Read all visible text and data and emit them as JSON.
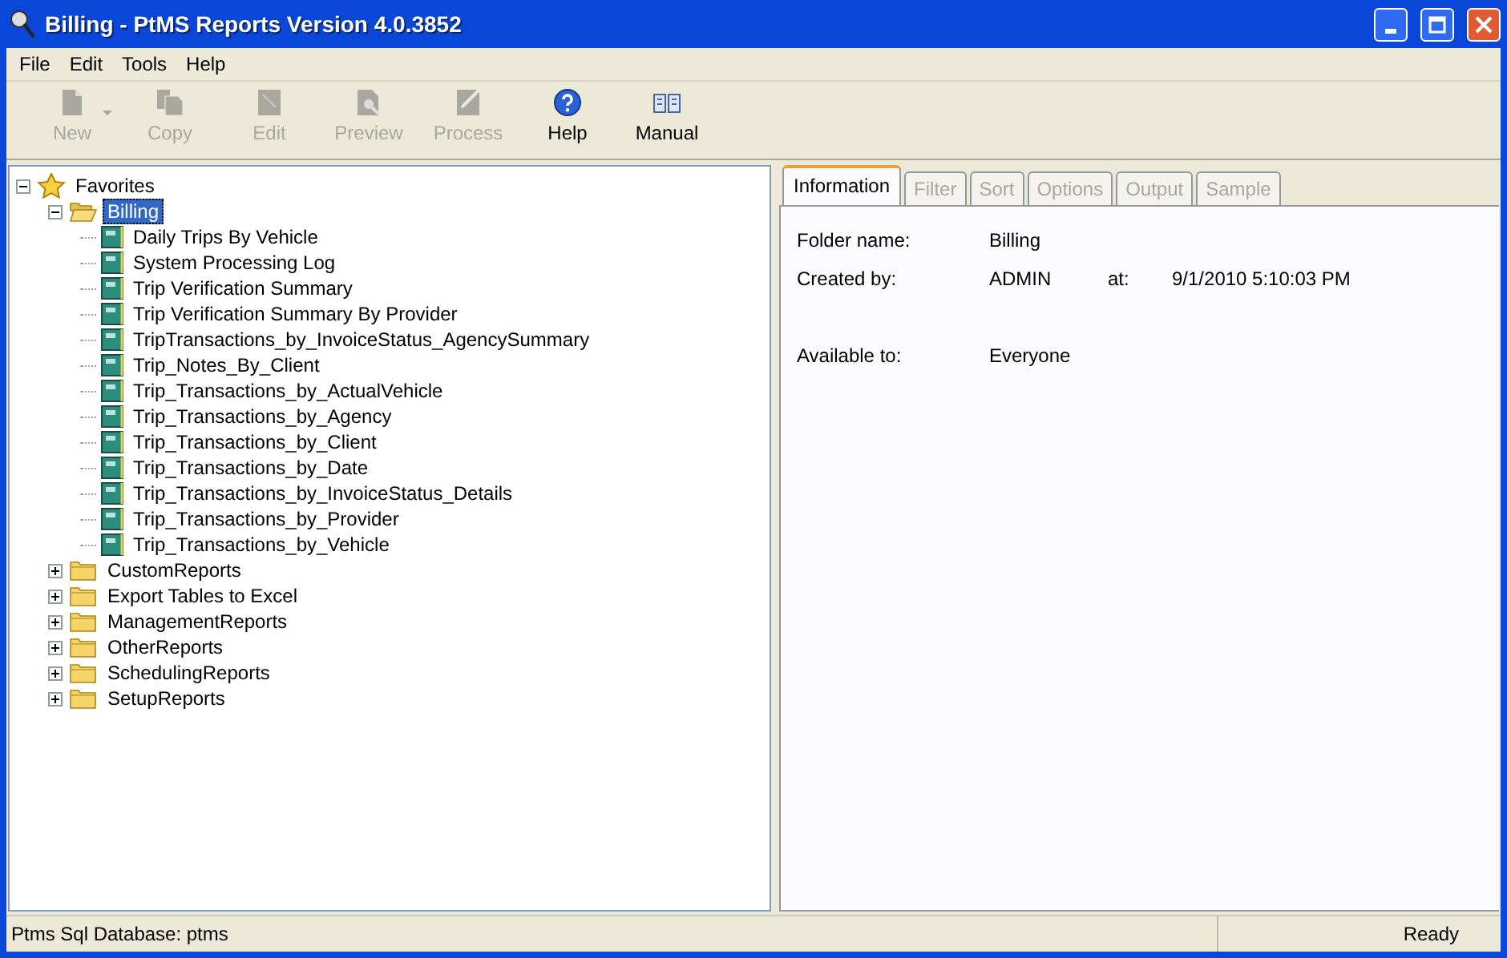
{
  "window": {
    "title": "Billing - PtMS Reports Version 4.0.3852"
  },
  "menu": [
    "File",
    "Edit",
    "Tools",
    "Help"
  ],
  "toolbar": [
    {
      "label": "New",
      "kind": "new",
      "disabled": true,
      "dropdown": true
    },
    {
      "label": "Copy",
      "kind": "copy",
      "disabled": true
    },
    {
      "label": "Edit",
      "kind": "edit",
      "disabled": true
    },
    {
      "label": "Preview",
      "kind": "preview",
      "disabled": true
    },
    {
      "label": "Process",
      "kind": "process",
      "disabled": true
    },
    {
      "label": "Help",
      "kind": "help",
      "disabled": false
    },
    {
      "label": "Manual",
      "kind": "manual",
      "disabled": false
    }
  ],
  "tree": [
    {
      "label": "Favorites",
      "kind": "favorites",
      "expanded": true,
      "selected": false,
      "children": [
        {
          "label": "Billing",
          "kind": "folder",
          "expanded": true,
          "selected": true,
          "children": [
            {
              "label": "Daily Trips By Vehicle",
              "kind": "report",
              "selected": false
            },
            {
              "label": "System Processing Log",
              "kind": "report",
              "selected": false
            },
            {
              "label": "Trip Verification Summary",
              "kind": "report",
              "selected": false
            },
            {
              "label": "Trip Verification Summary By Provider",
              "kind": "report",
              "selected": false
            },
            {
              "label": "TripTransactions_by_InvoiceStatus_AgencySummary",
              "kind": "report",
              "selected": false
            },
            {
              "label": "Trip_Notes_By_Client",
              "kind": "report",
              "selected": false
            },
            {
              "label": "Trip_Transactions_by_ActualVehicle",
              "kind": "report",
              "selected": false
            },
            {
              "label": "Trip_Transactions_by_Agency",
              "kind": "report",
              "selected": false
            },
            {
              "label": "Trip_Transactions_by_Client",
              "kind": "report",
              "selected": false
            },
            {
              "label": "Trip_Transactions_by_Date",
              "kind": "report",
              "selected": false
            },
            {
              "label": "Trip_Transactions_by_InvoiceStatus_Details",
              "kind": "report",
              "selected": false
            },
            {
              "label": "Trip_Transactions_by_Provider",
              "kind": "report",
              "selected": false
            },
            {
              "label": "Trip_Transactions_by_Vehicle",
              "kind": "report",
              "selected": false
            }
          ]
        },
        {
          "label": "CustomReports",
          "kind": "folder",
          "expanded": false,
          "selected": false
        },
        {
          "label": "Export Tables to Excel",
          "kind": "folder",
          "expanded": false,
          "selected": false
        },
        {
          "label": "ManagementReports",
          "kind": "folder",
          "expanded": false,
          "selected": false
        },
        {
          "label": "OtherReports",
          "kind": "folder",
          "expanded": false,
          "selected": false
        },
        {
          "label": "SchedulingReports",
          "kind": "folder",
          "expanded": false,
          "selected": false
        },
        {
          "label": "SetupReports",
          "kind": "folder",
          "expanded": false,
          "selected": false
        }
      ]
    }
  ],
  "tabs": [
    {
      "label": "Information",
      "selected": true,
      "disabled": false
    },
    {
      "label": "Filter",
      "selected": false,
      "disabled": true
    },
    {
      "label": "Sort",
      "selected": false,
      "disabled": true
    },
    {
      "label": "Options",
      "selected": false,
      "disabled": true
    },
    {
      "label": "Output",
      "selected": false,
      "disabled": true
    },
    {
      "label": "Sample",
      "selected": false,
      "disabled": true
    }
  ],
  "info": {
    "folder_name_label": "Folder name:",
    "folder_name": "Billing",
    "created_by_label": "Created by:",
    "created_by": "ADMIN",
    "at_label": "at:",
    "created_at": "9/1/2010 5:10:03 PM",
    "available_to_label": "Available to:",
    "available_to": "Everyone"
  },
  "status_bar": {
    "database": "Ptms Sql Database: ptms",
    "state": "Ready"
  }
}
